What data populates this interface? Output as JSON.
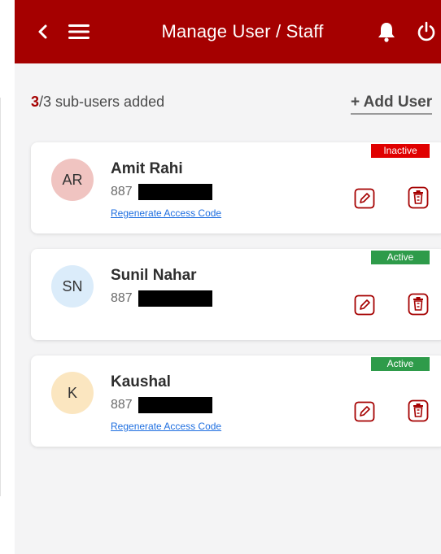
{
  "header": {
    "title": "Manage User / Staff",
    "back_icon": "chevron-left-icon",
    "menu_icon": "hamburger-menu-icon",
    "bell_icon": "bell-icon",
    "power_icon": "power-icon",
    "background": "#a50000"
  },
  "summary": {
    "added": "3",
    "rest": "/3 sub-users added",
    "add_user_label": "+ Add User"
  },
  "users": [
    {
      "initials": "AR",
      "name": "Amit Rahi",
      "phone_prefix": "887",
      "status": "Inactive",
      "status_color": "#e00000",
      "avatar_color": "#f0c4c1",
      "regenerate_label": "Regenerate Access Code"
    },
    {
      "initials": "SN",
      "name": "Sunil Nahar",
      "phone_prefix": "887",
      "status": "Active",
      "status_color": "#2e9b4a",
      "avatar_color": "#dbecfa"
    },
    {
      "initials": "K",
      "name": "Kaushal",
      "phone_prefix": "887",
      "status": "Active",
      "status_color": "#2e9b4a",
      "avatar_color": "#fbe6c0",
      "regenerate_label": "Regenerate Access Code"
    }
  ],
  "icons": {
    "edit": "edit-pencil-icon",
    "delete": "trash-icon",
    "icon_color": "#a50000"
  }
}
